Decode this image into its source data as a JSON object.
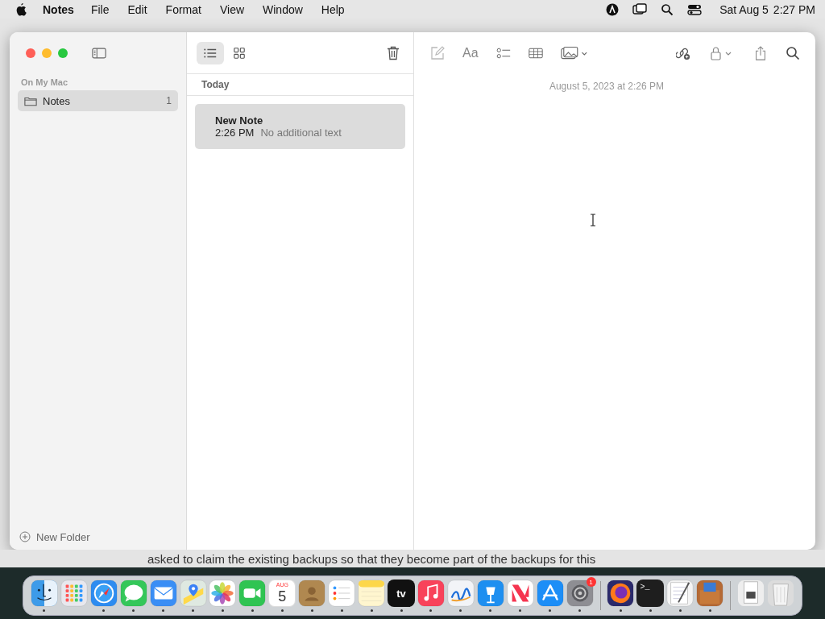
{
  "menu_bar": {
    "app": "Notes",
    "menus": [
      "File",
      "Edit",
      "Format",
      "View",
      "Window",
      "Help"
    ],
    "date": "Sat Aug 5",
    "time": "2:27 PM"
  },
  "sidebar": {
    "section": "On My Mac",
    "folders": [
      {
        "name": "Notes",
        "count": "1",
        "selected": true
      }
    ],
    "new_folder": "New Folder"
  },
  "note_list": {
    "view_modes": [
      {
        "kind": "list",
        "selected": true
      },
      {
        "kind": "gallery",
        "selected": false
      }
    ],
    "group": "Today",
    "notes": [
      {
        "title": "New Note",
        "time": "2:26 PM",
        "preview": "No additional text",
        "selected": true
      }
    ]
  },
  "editor": {
    "toolbar": [
      {
        "kind": "compose",
        "disabled": true
      },
      {
        "kind": "format",
        "disabled": false
      },
      {
        "kind": "checklist",
        "disabled": false
      },
      {
        "kind": "table",
        "disabled": false
      },
      {
        "kind": "media",
        "disabled": false
      },
      {
        "kind": "collaborate",
        "disabled": false
      },
      {
        "kind": "lock",
        "disabled": false
      },
      {
        "kind": "share",
        "disabled": false
      },
      {
        "kind": "search",
        "disabled": false
      }
    ],
    "format_label": "Aa",
    "timestamp": "August 5, 2023 at 2:26 PM"
  },
  "background_text": "asked to claim the existing backups so that they become part of the backups for this",
  "dock": {
    "apps": [
      {
        "kind": "finder",
        "running": true
      },
      {
        "kind": "launchpad",
        "running": false
      },
      {
        "kind": "safari",
        "running": true
      },
      {
        "kind": "messages",
        "running": true
      },
      {
        "kind": "mail",
        "running": true
      },
      {
        "kind": "maps",
        "running": true
      },
      {
        "kind": "photos",
        "running": true
      },
      {
        "kind": "facetime",
        "running": true
      },
      {
        "kind": "calendar",
        "running": true,
        "month": "AUG",
        "day": "5"
      },
      {
        "kind": "contacts",
        "running": true
      },
      {
        "kind": "reminders",
        "running": true
      },
      {
        "kind": "notes",
        "running": true
      },
      {
        "kind": "tv",
        "running": true,
        "label": "tv"
      },
      {
        "kind": "music",
        "running": true
      },
      {
        "kind": "freeform",
        "running": true
      },
      {
        "kind": "keynote",
        "running": true
      },
      {
        "kind": "news",
        "running": true
      },
      {
        "kind": "appstore",
        "running": true
      },
      {
        "kind": "settings",
        "running": true,
        "badge": "1"
      },
      {
        "kind": "separator"
      },
      {
        "kind": "firefox",
        "running": true
      },
      {
        "kind": "terminal",
        "running": true,
        "label": ">_"
      },
      {
        "kind": "textedit",
        "running": true
      },
      {
        "kind": "archive",
        "running": true
      },
      {
        "kind": "separator"
      },
      {
        "kind": "document",
        "running": false
      },
      {
        "kind": "trash",
        "running": false
      }
    ]
  }
}
